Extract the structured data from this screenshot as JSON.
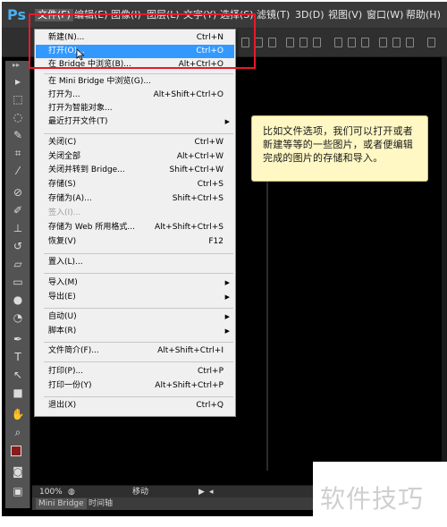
{
  "app": {
    "logo": "Ps"
  },
  "menubar": {
    "items": [
      {
        "label": "文件(F)"
      },
      {
        "label": "编辑(E)"
      },
      {
        "label": "图像(I)"
      },
      {
        "label": "图层(L)"
      },
      {
        "label": "文字(Y)"
      },
      {
        "label": "选择(S)"
      },
      {
        "label": "滤镜(T)"
      },
      {
        "label": "3D(D)"
      },
      {
        "label": "视图(V)"
      },
      {
        "label": "窗口(W)"
      },
      {
        "label": "帮助(H)"
      }
    ]
  },
  "file_menu": {
    "items": [
      {
        "label": "新建(N)...",
        "shortcut": "Ctrl+N"
      },
      {
        "label": "打开(O)...",
        "shortcut": "Ctrl+O"
      },
      {
        "label": "在 Bridge 中浏览(B)...",
        "shortcut": "Alt+Ctrl+O"
      },
      {
        "label": "在 Mini Bridge 中浏览(G)...",
        "shortcut": ""
      },
      {
        "label": "打开为...",
        "shortcut": "Alt+Shift+Ctrl+O"
      },
      {
        "label": "打开为智能对象...",
        "shortcut": ""
      },
      {
        "label": "最近打开文件(T)",
        "shortcut": ""
      },
      {
        "label": "关闭(C)",
        "shortcut": "Ctrl+W"
      },
      {
        "label": "关闭全部",
        "shortcut": "Alt+Ctrl+W"
      },
      {
        "label": "关闭并转到 Bridge...",
        "shortcut": "Shift+Ctrl+W"
      },
      {
        "label": "存储(S)",
        "shortcut": "Ctrl+S"
      },
      {
        "label": "存储为(A)...",
        "shortcut": "Shift+Ctrl+S"
      },
      {
        "label": "签入(I)...",
        "shortcut": ""
      },
      {
        "label": "存储为 Web 所用格式...",
        "shortcut": "Alt+Shift+Ctrl+S"
      },
      {
        "label": "恢复(V)",
        "shortcut": "F12"
      },
      {
        "label": "置入(L)...",
        "shortcut": ""
      },
      {
        "label": "导入(M)",
        "shortcut": ""
      },
      {
        "label": "导出(E)",
        "shortcut": ""
      },
      {
        "label": "自动(U)",
        "shortcut": ""
      },
      {
        "label": "脚本(R)",
        "shortcut": ""
      },
      {
        "label": "文件简介(F)...",
        "shortcut": "Alt+Shift+Ctrl+I"
      },
      {
        "label": "打印(P)...",
        "shortcut": "Ctrl+P"
      },
      {
        "label": "打印一份(Y)",
        "shortcut": "Alt+Shift+Ctrl+P"
      },
      {
        "label": "退出(X)",
        "shortcut": "Ctrl+Q"
      }
    ]
  },
  "note": {
    "text": "比如文件选项，我们可以打开或者新建等等的一些图片，或者便编辑完成的图片的存储和导入。"
  },
  "statusbar": {
    "zoom": "100%",
    "mode": "移动"
  },
  "panels": {
    "tabs": [
      "Mini Bridge",
      "时间轴"
    ]
  },
  "watermark": {
    "text": "软件技巧"
  },
  "colors": {
    "highlight": "#e8192c",
    "menu_hover": "#3399ff",
    "foreground": "#8b1a1a",
    "background": "#ffffff"
  },
  "icons": [
    "move-tool-icon",
    "marquee-tool-icon",
    "lasso-tool-icon",
    "quick-select-tool-icon",
    "crop-tool-icon",
    "eyedropper-tool-icon",
    "healing-brush-icon",
    "brush-tool-icon",
    "clone-stamp-icon",
    "history-brush-icon",
    "eraser-tool-icon",
    "gradient-tool-icon",
    "blur-tool-icon",
    "dodge-tool-icon",
    "pen-tool-icon",
    "type-tool-icon",
    "path-select-icon",
    "shape-tool-icon",
    "hand-tool-icon",
    "zoom-tool-icon"
  ]
}
